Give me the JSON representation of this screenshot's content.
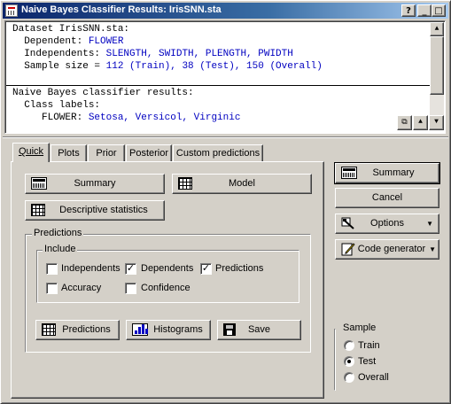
{
  "window": {
    "title": "Naive Bayes Classifier Results: IrisSNN.sta",
    "help_glyph": "?",
    "minimize_glyph": "_",
    "maximize_glyph": "□",
    "close_glyph": "✕"
  },
  "results": {
    "dataset_label": "Dataset IrisSNN.sta:",
    "dependent_label": "  Dependent: ",
    "dependent_value": "FLOWER",
    "independents_label": "  Independents: ",
    "independents_value": "SLENGTH, SWIDTH, PLENGTH, PWIDTH",
    "sample_label": "  Sample size = ",
    "sample_value": "112 (Train), 38 (Test), 150 (Overall)",
    "classifier_header": "Naive Bayes classifier results:",
    "class_labels_label": "  Class labels:",
    "flower_label": "     FLOWER: ",
    "flower_value": "Setosa, Versicol, Virginic"
  },
  "tabs": [
    {
      "label": "Quick"
    },
    {
      "label": "Plots"
    },
    {
      "label": "Prior"
    },
    {
      "label": "Posterior"
    },
    {
      "label": "Custom predictions"
    }
  ],
  "quick": {
    "summary_label": "Summary",
    "model_label": "Model",
    "descriptive_label": "Descriptive statistics",
    "predictions_group": "Predictions",
    "include_group": "Include",
    "checks": {
      "independents": {
        "label": "Independents",
        "checked": false
      },
      "dependents": {
        "label": "Dependents",
        "checked": true
      },
      "predictions": {
        "label": "Predictions",
        "checked": true
      },
      "accuracy": {
        "label": "Accuracy",
        "checked": false
      },
      "confidence": {
        "label": "Confidence",
        "checked": false
      }
    },
    "predictions_btn": "Predictions",
    "histograms_btn": "Histograms",
    "save_btn": "Save"
  },
  "side": {
    "summary_label": "Summary",
    "cancel_label": "Cancel",
    "options_label": "Options",
    "code_generator_label": "Code generator",
    "sample_group": "Sample",
    "radios": [
      {
        "label": "Train",
        "selected": false
      },
      {
        "label": "Test",
        "selected": true
      },
      {
        "label": "Overall",
        "selected": false
      }
    ]
  },
  "check_glyph": "✓",
  "caret_glyph": "▼"
}
